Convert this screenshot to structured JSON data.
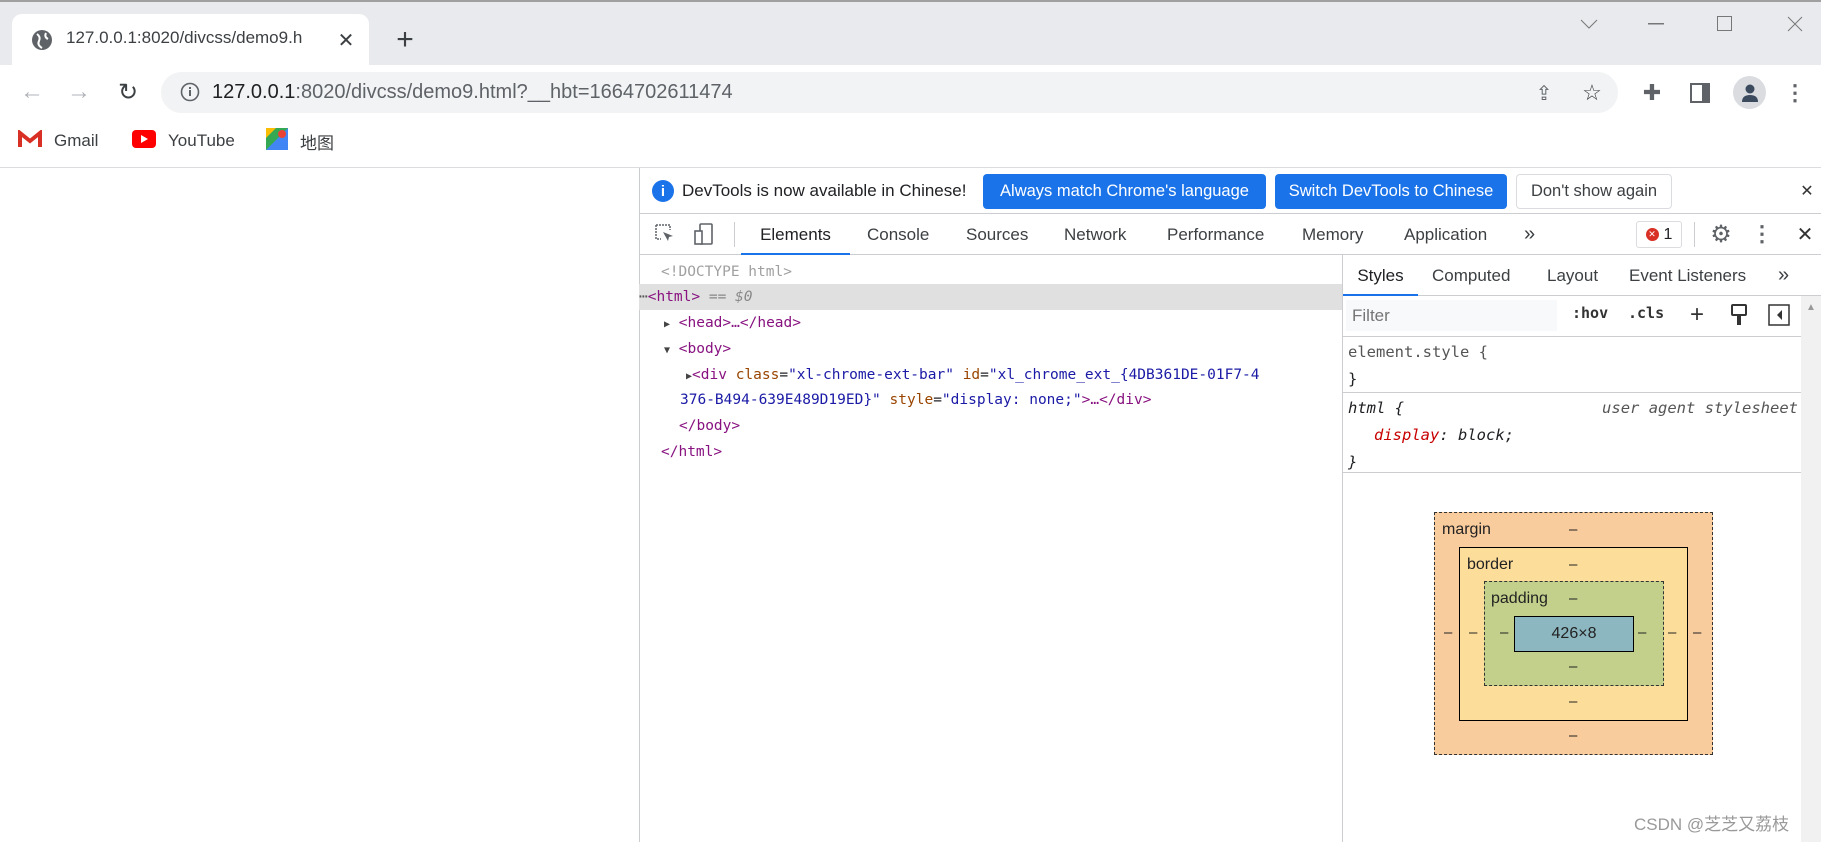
{
  "browser": {
    "tab_title": "127.0.0.1:8020/divcss/demo9.h",
    "url_host": "127.0.0.1",
    "url_rest": ":8020/divcss/demo9.html?__hbt=1664702611474",
    "bookmarks": [
      {
        "label": "Gmail",
        "icon": "gmail-icon"
      },
      {
        "label": "YouTube",
        "icon": "youtube-icon"
      },
      {
        "label": "地图",
        "icon": "maps-icon"
      }
    ]
  },
  "devtools": {
    "infobar": {
      "message": "DevTools is now available in Chinese!",
      "btn_match": "Always match Chrome's language",
      "btn_switch": "Switch DevTools to Chinese",
      "btn_dismiss": "Don't show again"
    },
    "tabs": [
      "Elements",
      "Console",
      "Sources",
      "Network",
      "Performance",
      "Memory",
      "Application"
    ],
    "active_tab": "Elements",
    "error_count": "1",
    "dom": {
      "doctype": "<!DOCTYPE html>",
      "html_open": "<html>",
      "selected_marker": "== $0",
      "head": "<head>…</head>",
      "body_open": "<body>",
      "div_tag": "<div ",
      "class_attr": "class",
      "class_val": "\"xl-chrome-ext-bar\"",
      "id_attr": "id",
      "id_val_1": "\"xl_chrome_ext_{4DB361DE-01F7-4",
      "id_val_2": "376-B494-639E489D19ED}\"",
      "style_attr": "style",
      "style_val": "\"display: none;\"",
      "div_close": ">…</div>",
      "body_close": "</body>",
      "html_close": "</html>"
    },
    "styles": {
      "tabs": [
        "Styles",
        "Computed",
        "Layout",
        "Event Listeners"
      ],
      "filter_placeholder": "Filter",
      "hov": ":hov",
      "cls": ".cls",
      "element_style": "element.style {",
      "close_brace": "}",
      "html_selector": "html {",
      "ua_label": "user agent stylesheet",
      "prop": "display",
      "prop_val": "block;"
    },
    "box_model": {
      "margin_label": "margin",
      "border_label": "border",
      "padding_label": "padding",
      "content": "426×8",
      "empty": "–",
      "colors": {
        "margin": "#f9cc9d",
        "border": "#fcdd9a",
        "padding": "#c3d08b",
        "content": "#8cb6c0"
      }
    }
  },
  "watermark": "CSDN @芝芝又荔枝",
  "colors": {
    "accent": "#1a73e8"
  }
}
